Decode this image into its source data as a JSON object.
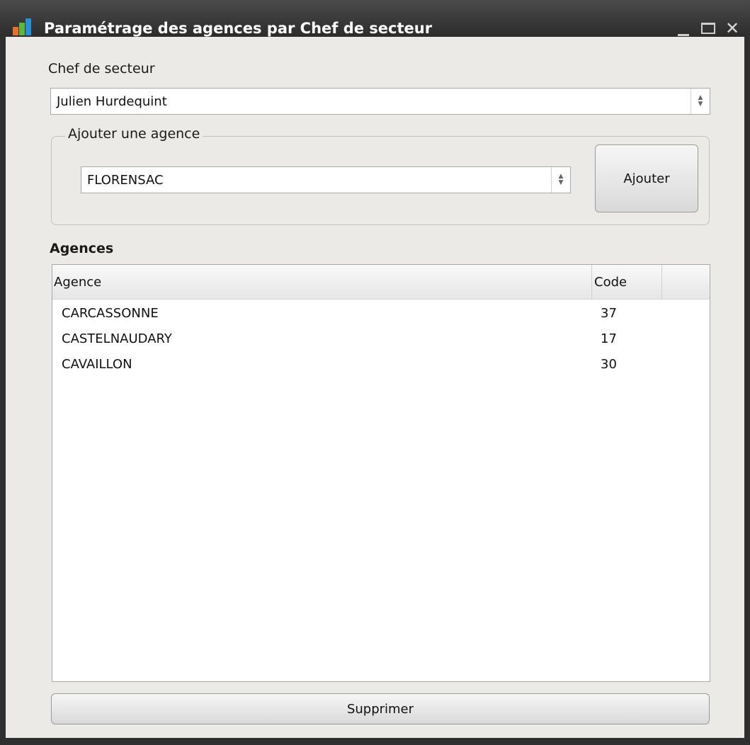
{
  "window": {
    "title": "Paramétrage des agences par Chef de secteur",
    "controls": {
      "minimize": "minimize-icon",
      "maximize": "maximize-icon",
      "close": "close-icon"
    }
  },
  "chef": {
    "label": "Chef de secteur",
    "value": "Julien Hurdequint"
  },
  "ajout": {
    "group_title": "Ajouter une agence",
    "value": "FLORENSAC",
    "button_label": "Ajouter"
  },
  "agences": {
    "heading": "Agences",
    "columns": [
      "Agence",
      "Code"
    ],
    "rows": [
      {
        "agence": "CARCASSONNE",
        "code": "37"
      },
      {
        "agence": "CASTELNAUDARY",
        "code": "17"
      },
      {
        "agence": "CAVAILLON",
        "code": "30"
      }
    ]
  },
  "footer": {
    "delete_label": "Supprimer"
  },
  "colors": {
    "titlebar": "#2c2c2c",
    "client_bg": "#eceae6",
    "icon_orange": "#e8702a",
    "icon_blue": "#2b8fd6",
    "icon_green": "#5cb83a"
  }
}
